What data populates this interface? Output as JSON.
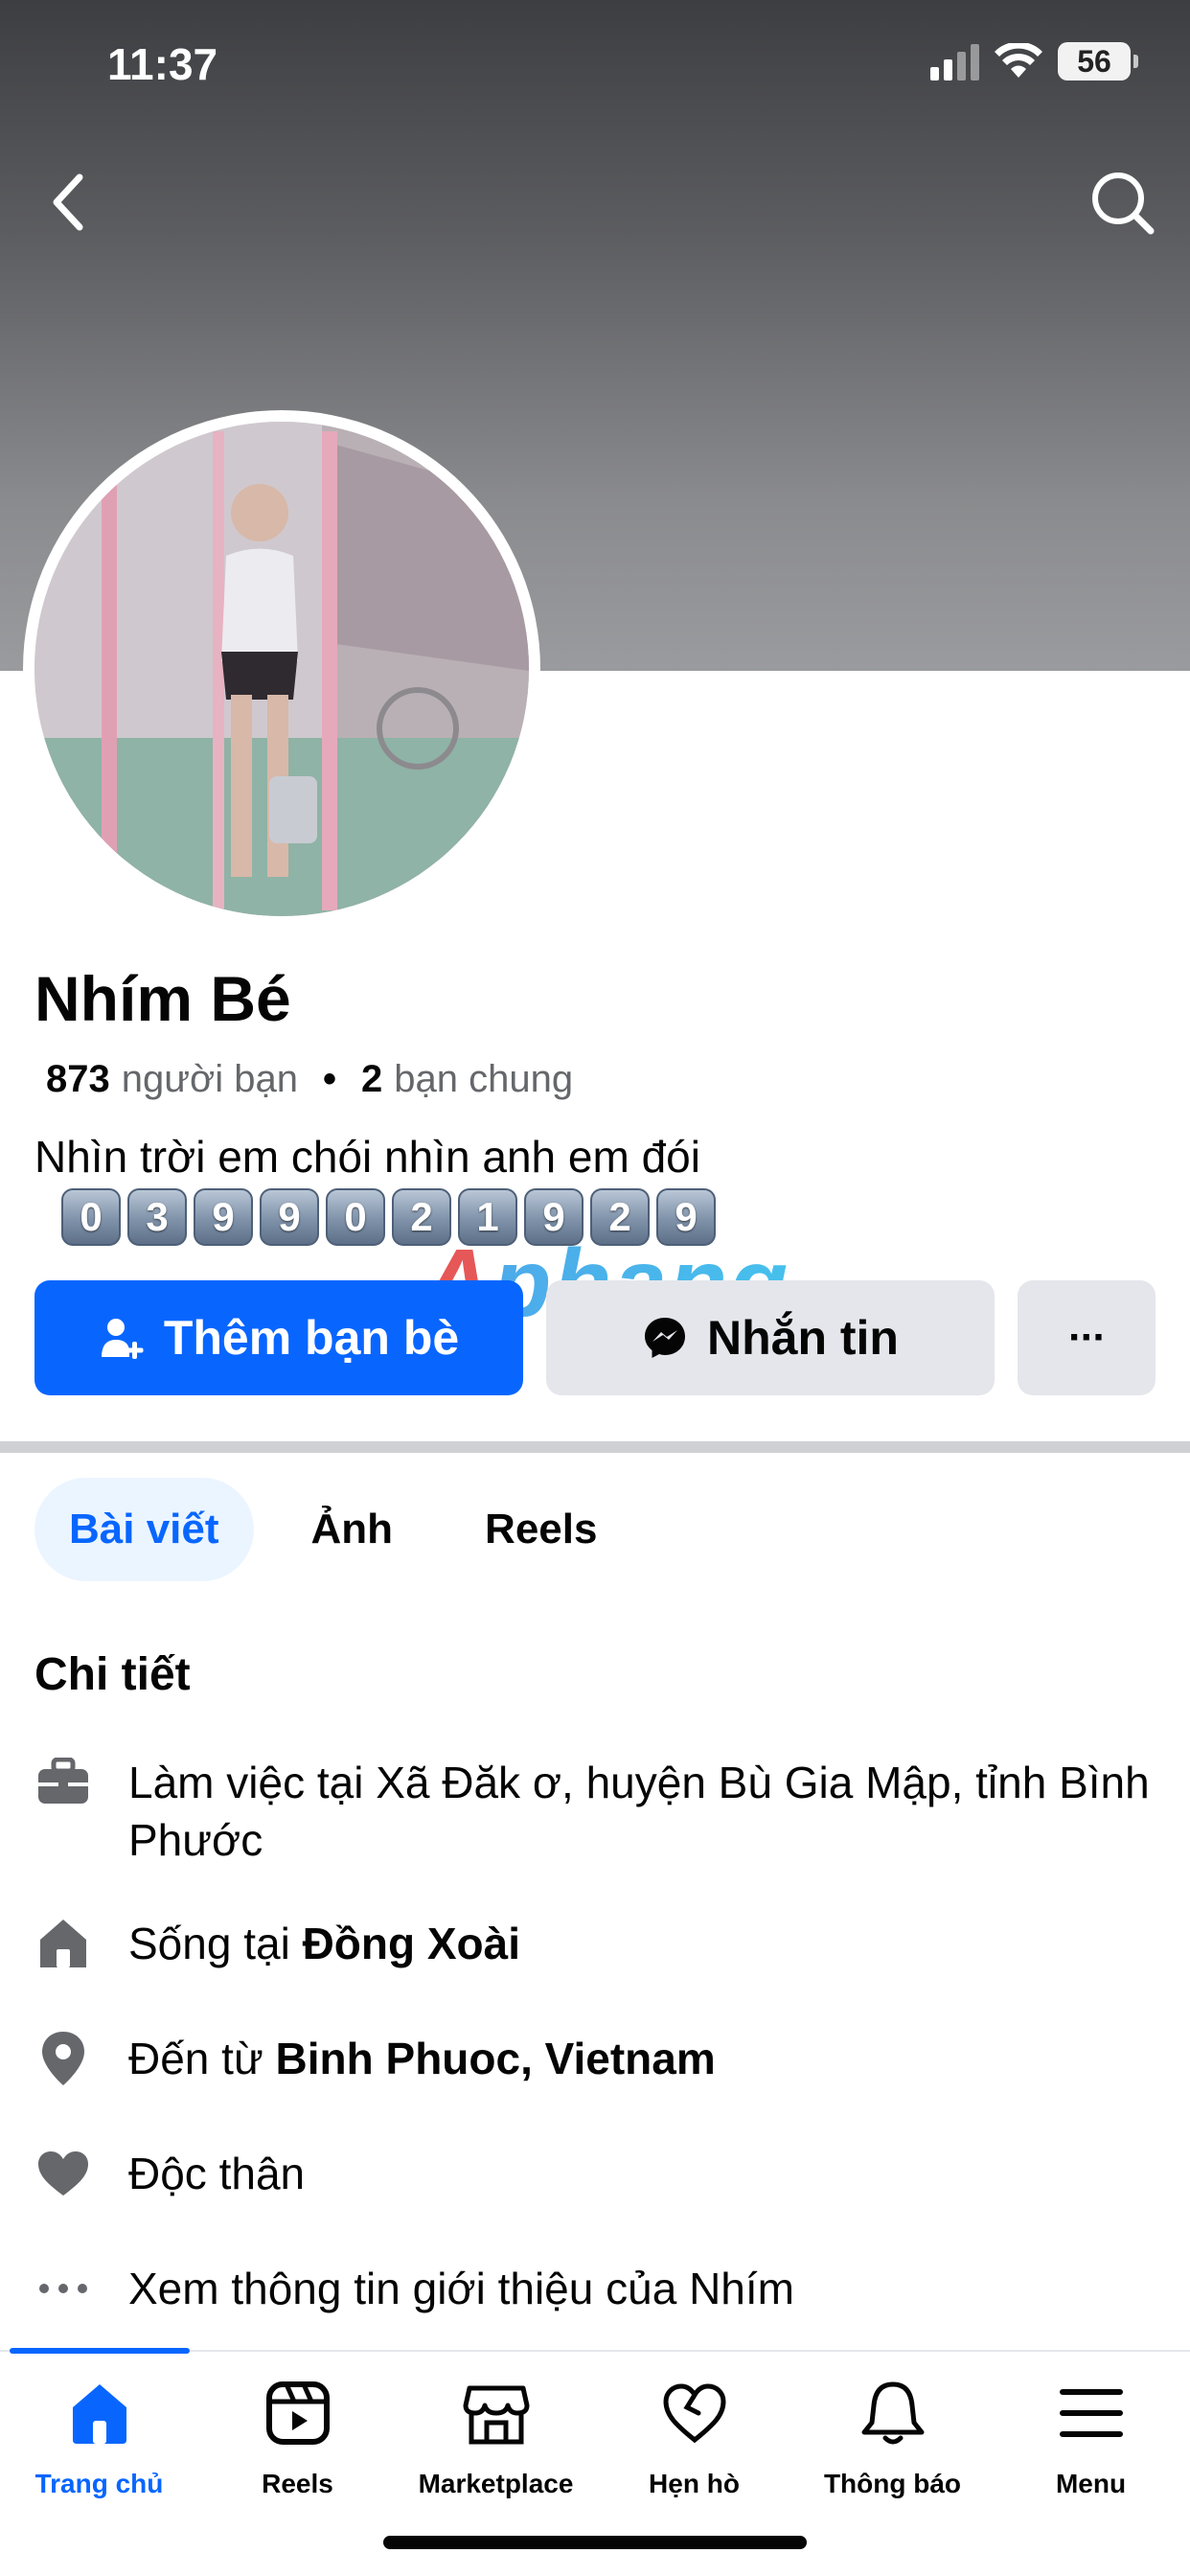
{
  "status_bar": {
    "time": "11:37",
    "battery": "56",
    "signal_bars": 2,
    "wifi": true
  },
  "header": {
    "back_icon": "chevron-left-icon",
    "search_icon": "search-icon"
  },
  "profile": {
    "name": "Nhím Bé",
    "friends_count": "873",
    "friends_label": "người bạn",
    "mutual_count": "2",
    "mutual_label": "bạn chung",
    "bio": "Nhìn trời em chói nhìn anh em đói",
    "phone_digits": [
      "0",
      "3",
      "9",
      "9",
      "0",
      "2",
      "1",
      "9",
      "2",
      "9"
    ]
  },
  "watermark": "Aphang",
  "actions": {
    "add_friend_label": "Thêm bạn bè",
    "message_label": "Nhắn tin",
    "more_label": "···"
  },
  "tabs": [
    {
      "label": "Bài viết",
      "active": true
    },
    {
      "label": "Ảnh",
      "active": false
    },
    {
      "label": "Reels",
      "active": false
    }
  ],
  "details": {
    "title": "Chi tiết",
    "work": {
      "icon": "briefcase-icon",
      "text": "Làm việc tại Xã Đăk ơ, huyện Bù Gia Mập, tỉnh Bình Phước"
    },
    "lives": {
      "icon": "house-icon",
      "prefix": "Sống tại ",
      "place": "Đồng Xoài"
    },
    "from": {
      "icon": "location-pin-icon",
      "prefix": "Đến từ ",
      "place": "Binh Phuoc, Vietnam"
    },
    "relationship": {
      "icon": "heart-icon",
      "text": "Độc thân"
    },
    "more_info": {
      "icon": "more-dots-icon",
      "text": "Xem thông tin giới thiệu của Nhím"
    }
  },
  "bottom_nav": [
    {
      "label": "Trang chủ",
      "icon": "home-icon",
      "active": true
    },
    {
      "label": "Reels",
      "icon": "reels-icon",
      "active": false
    },
    {
      "label": "Marketplace",
      "icon": "marketplace-icon",
      "active": false
    },
    {
      "label": "Hẹn hò",
      "icon": "dating-heart-icon",
      "active": false
    },
    {
      "label": "Thông báo",
      "icon": "bell-icon",
      "active": false
    },
    {
      "label": "Menu",
      "icon": "menu-icon",
      "active": false
    }
  ],
  "colors": {
    "brand_blue": "#0866ff",
    "secondary_button": "#e4e6eb",
    "muted_text": "#65676b"
  }
}
